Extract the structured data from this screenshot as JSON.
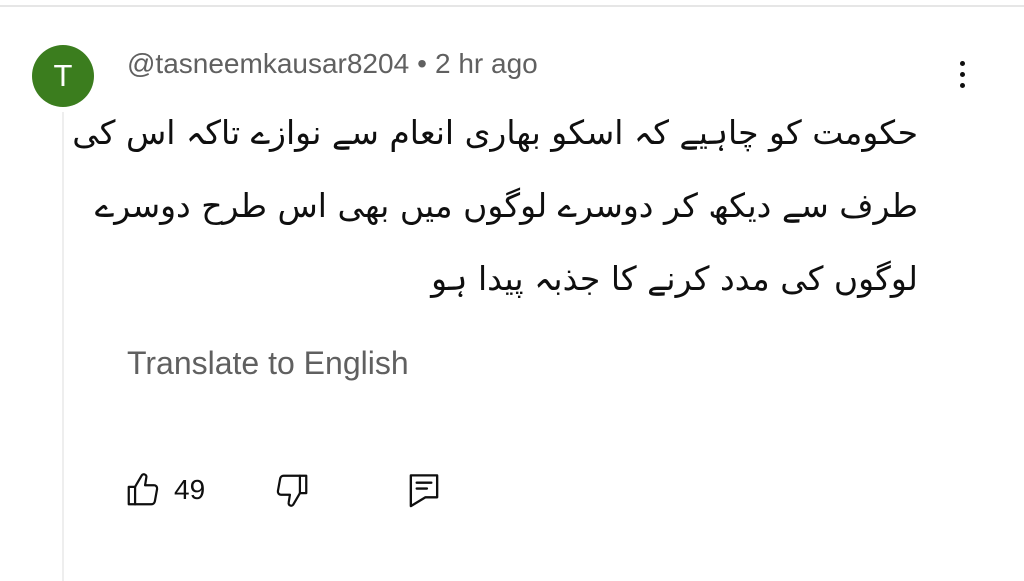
{
  "comment": {
    "avatar_letter": "T",
    "avatar_color": "#3b7d1e",
    "author": "@tasneemkausar8204",
    "separator": "•",
    "time": "2 hr ago",
    "text_lines": [
      "حکومت کو چاہیے کہ اسکو بھاری انعام سے نوازے تاکہ اس کی",
      "طرف سے دیکھ کر دوسرے لوگوں میں بھی اس طرح دوسرے",
      "لوگوں کی مدد کرنے کا جذبہ پیدا ہو"
    ],
    "translate_label": "Translate to English"
  },
  "actions": {
    "like_count": "49",
    "like_icon": "thumbs-up-icon",
    "dislike_icon": "thumbs-down-icon",
    "reply_icon": "comment-icon",
    "more_icon": "more-vertical-icon"
  }
}
